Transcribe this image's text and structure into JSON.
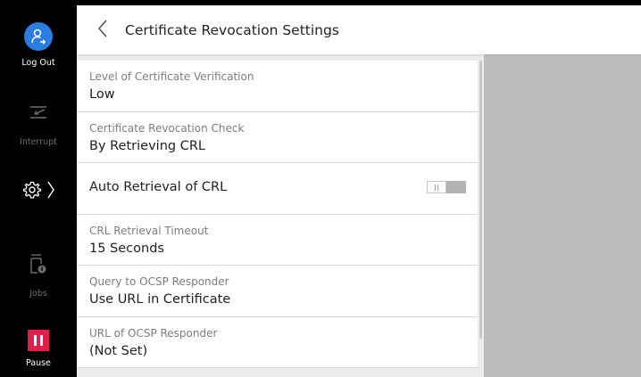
{
  "sidebar": {
    "logout_label": "Log Out",
    "interrupt_label": "Interrupt",
    "jobs_label": "Jobs",
    "pause_label": "Pause"
  },
  "header": {
    "title": "Certificate Revocation Settings"
  },
  "settings": [
    {
      "title": "Level of Certificate Verification",
      "value": "Low"
    },
    {
      "title": "Certificate Revocation Check",
      "value": "By Retrieving CRL"
    },
    {
      "label": "Auto Retrieval of CRL",
      "toggle_on": false
    },
    {
      "title": "CRL Retrieval Timeout",
      "value": "15 Seconds"
    },
    {
      "title": "Query to OCSP Responder",
      "value": "Use URL in Certificate"
    },
    {
      "title": "URL of OCSP Responder",
      "value": "(Not Set)"
    }
  ],
  "colors": {
    "accent_blue": "#2a7de1",
    "pause_red": "#e11d4a"
  }
}
